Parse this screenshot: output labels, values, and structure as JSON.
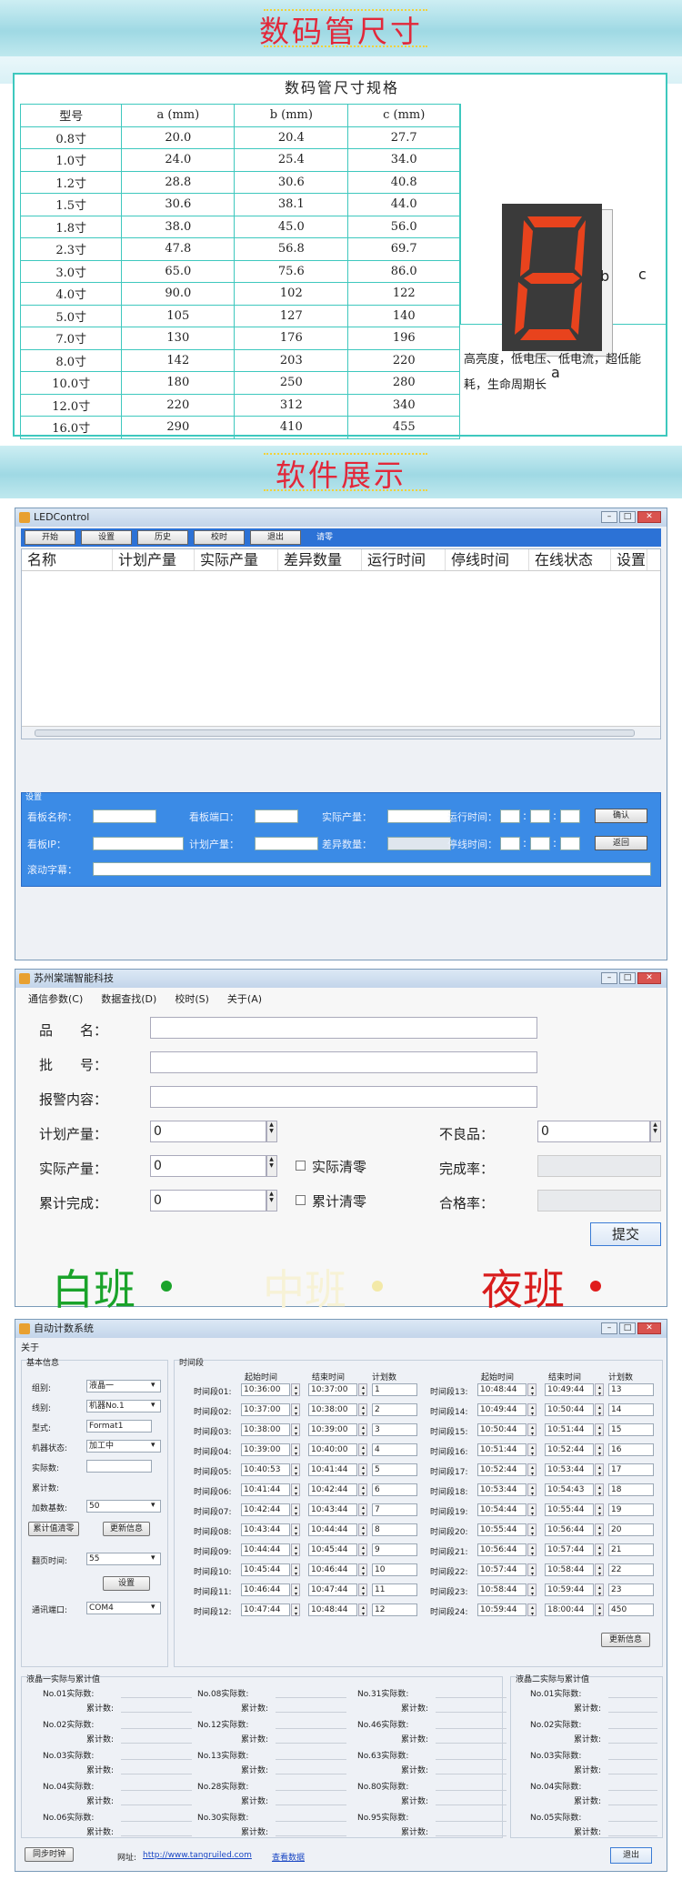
{
  "banner1": {
    "title": "数码管尺寸"
  },
  "spec": {
    "caption": "数码管尺寸规格",
    "headers": [
      "型号",
      "a (mm)",
      "b (mm)",
      "c (mm)"
    ],
    "rows": [
      [
        "0.8寸",
        "20.0",
        "20.4",
        "27.7"
      ],
      [
        "1.0寸",
        "24.0",
        "25.4",
        "34.0"
      ],
      [
        "1.2寸",
        "28.8",
        "30.6",
        "40.8"
      ],
      [
        "1.5寸",
        "30.6",
        "38.1",
        "44.0"
      ],
      [
        "1.8寸",
        "38.0",
        "45.0",
        "56.0"
      ],
      [
        "2.3寸",
        "47.8",
        "56.8",
        "69.7"
      ],
      [
        "3.0寸",
        "65.0",
        "75.6",
        "86.0"
      ],
      [
        "4.0寸",
        "90.0",
        "102",
        "122"
      ],
      [
        "5.0寸",
        "105",
        "127",
        "140"
      ],
      [
        "7.0寸",
        "130",
        "176",
        "196"
      ],
      [
        "8.0寸",
        "142",
        "203",
        "220"
      ],
      [
        "10.0寸",
        "180",
        "250",
        "280"
      ],
      [
        "12.0寸",
        "220",
        "312",
        "340"
      ],
      [
        "16.0寸",
        "290",
        "410",
        "455"
      ]
    ],
    "digit_labels": {
      "a": "a",
      "b": "b",
      "c": "c"
    },
    "note": "高亮度，低电压、低电流，超低能耗，生命周期长"
  },
  "banner2": {
    "title": "软件展示"
  },
  "led": {
    "title": "LEDControl",
    "toolbar": [
      "开始",
      "设置",
      "历史",
      "校时",
      "退出",
      "请零"
    ],
    "columns": [
      "名称",
      "计划产量",
      "实际产量",
      "差异数量",
      "运行时间",
      "停线时间",
      "在线状态",
      "设置"
    ],
    "group": "设置",
    "labels": {
      "board_name": "看板名称：",
      "board_port": "看板端口：",
      "actual": "实际产量：",
      "run_time": "运行时间：",
      "board_ip": "看板IP：",
      "plan": "计划产量：",
      "diff": "差异数量：",
      "stop_time": "停线时间：",
      "scroll": "滚动字幕："
    },
    "sep": ":",
    "confirm": "确认",
    "back": "返回"
  },
  "sr": {
    "title": "苏州棠瑞智能科技",
    "menu": [
      "通信参数(C)",
      "数据查找(D)",
      "校时(S)",
      "关于(A)"
    ],
    "labels": {
      "name": "品　　名：",
      "batch": "批　　号：",
      "alarm": "报警内容：",
      "plan": "计划产量：",
      "actual": "实际产量：",
      "cum": "累计完成：",
      "bad": "不良品：",
      "rate": "完成率：",
      "pass": "合格率："
    },
    "values": {
      "plan": "0",
      "actual": "0",
      "cum": "0",
      "bad": "0"
    },
    "checks": {
      "actual_clear": "实际清零",
      "cum_clear": "累计清零"
    },
    "submit": "提交",
    "shifts": [
      {
        "name": "白班",
        "color": "#1aa32a",
        "dot": "#1aa32a"
      },
      {
        "name": "中班",
        "color": "#f7f2d6",
        "dot": "#f3e9a8"
      },
      {
        "name": "夜班",
        "color": "#d81c1c",
        "dot": "#e01c1c"
      }
    ]
  },
  "auto": {
    "title": "自动计数系统",
    "menu": "关于",
    "basic": {
      "header": "基本信息",
      "group_label": "组别:",
      "group_value": "液晶一",
      "line_label": "线别:",
      "line_value": "机器No.1",
      "type_label": "型式:",
      "type_value": "Format1",
      "state_label": "机器状态:",
      "state_value": "加工中",
      "actual_label": "实际数:",
      "cum_label": "累计数:",
      "base_label": "加数基数:",
      "base_value": "50",
      "clear_btn": "累计值清零",
      "update_btn": "更新信息",
      "page_label": "翻页时间:",
      "page_value": "55",
      "set_btn": "设置",
      "port_label": "通讯端口:",
      "port_value": "COM4"
    },
    "periods": {
      "header": "时间段",
      "col_start": "起始时间",
      "col_end": "结束时间",
      "col_plan": "计划数",
      "left": [
        [
          "时间段01:",
          "10:36:00",
          "10:37:00",
          "1"
        ],
        [
          "时间段02:",
          "10:37:00",
          "10:38:00",
          "2"
        ],
        [
          "时间段03:",
          "10:38:00",
          "10:39:00",
          "3"
        ],
        [
          "时间段04:",
          "10:39:00",
          "10:40:00",
          "4"
        ],
        [
          "时间段05:",
          "10:40:53",
          "10:41:44",
          "5"
        ],
        [
          "时间段06:",
          "10:41:44",
          "10:42:44",
          "6"
        ],
        [
          "时间段07:",
          "10:42:44",
          "10:43:44",
          "7"
        ],
        [
          "时间段08:",
          "10:43:44",
          "10:44:44",
          "8"
        ],
        [
          "时间段09:",
          "10:44:44",
          "10:45:44",
          "9"
        ],
        [
          "时间段10:",
          "10:45:44",
          "10:46:44",
          "10"
        ],
        [
          "时间段11:",
          "10:46:44",
          "10:47:44",
          "11"
        ],
        [
          "时间段12:",
          "10:47:44",
          "10:48:44",
          "12"
        ]
      ],
      "right": [
        [
          "时间段13:",
          "10:48:44",
          "10:49:44",
          "13"
        ],
        [
          "时间段14:",
          "10:49:44",
          "10:50:44",
          "14"
        ],
        [
          "时间段15:",
          "10:50:44",
          "10:51:44",
          "15"
        ],
        [
          "时间段16:",
          "10:51:44",
          "10:52:44",
          "16"
        ],
        [
          "时间段17:",
          "10:52:44",
          "10:53:44",
          "17"
        ],
        [
          "时间段18:",
          "10:53:44",
          "10:54:43",
          "18"
        ],
        [
          "时间段19:",
          "10:54:44",
          "10:55:44",
          "19"
        ],
        [
          "时间段20:",
          "10:55:44",
          "10:56:44",
          "20"
        ],
        [
          "时间段21:",
          "10:56:44",
          "10:57:44",
          "21"
        ],
        [
          "时间段22:",
          "10:57:44",
          "10:58:44",
          "22"
        ],
        [
          "时间段23:",
          "10:58:44",
          "10:59:44",
          "23"
        ],
        [
          "时间段24:",
          "10:59:44",
          "18:00:44",
          "450"
        ]
      ],
      "update_btn": "更新信息"
    },
    "g1": {
      "header": "液晶一实际与累计值",
      "cum": "累计数:",
      "cols": [
        [
          "No.01实际数:",
          "No.02实际数:",
          "No.03实际数:",
          "No.04实际数:",
          "No.06实际数:"
        ],
        [
          "No.08实际数:",
          "No.12实际数:",
          "No.13实际数:",
          "No.28实际数:",
          "No.30实际数:"
        ],
        [
          "No.31实际数:",
          "No.46实际数:",
          "No.63实际数:",
          "No.80实际数:",
          "No.95实际数:"
        ]
      ]
    },
    "g2": {
      "header": "液晶二实际与累计值",
      "cum": "累计数:",
      "items": [
        "No.01实际数:",
        "No.02实际数:",
        "No.03实际数:",
        "No.04实际数:",
        "No.05实际数:"
      ]
    },
    "footer": {
      "sync": "同步时钟",
      "site_label": "网址:",
      "site_url": "http://www.tangruiled.com",
      "view": "查看数据",
      "exit": "退出"
    }
  }
}
